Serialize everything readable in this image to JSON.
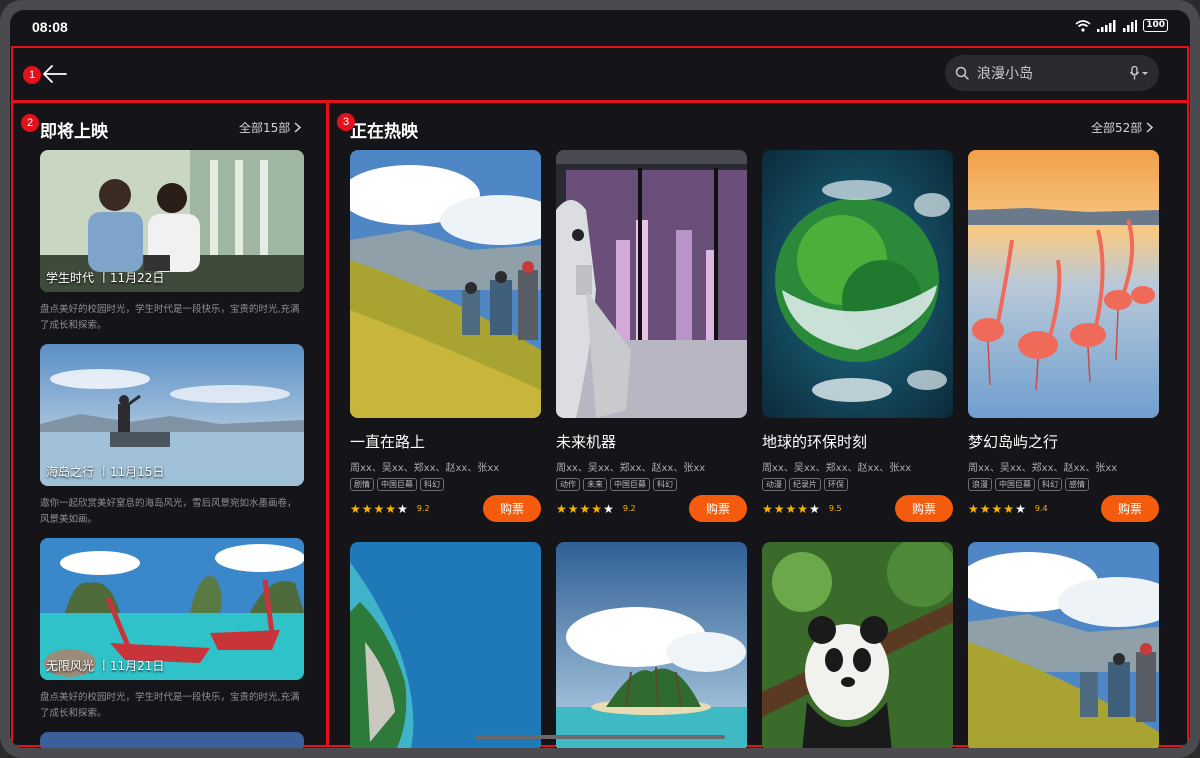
{
  "status": {
    "time": "08:08",
    "battery": "100"
  },
  "search": {
    "text": "浪漫小岛"
  },
  "regions": {
    "r1": "1",
    "r2": "2",
    "r3": "3"
  },
  "upcoming": {
    "title": "即将上映",
    "see_all": "全部15部",
    "items": [
      {
        "caption": "学生时代 丨11月22日",
        "desc": "盘点美好的校园时光，学生时代是一段快乐，宝贵的时光,充满了成长和探索。"
      },
      {
        "caption": "海岛之行 丨11月15日",
        "desc": "邀你一起欣赏美好窒息的海岛风光，雪后风景宛如水墨画卷，风景美如画。"
      },
      {
        "caption": "无限风光 丨11月21日",
        "desc": "盘点美好的校园时光，学生时代是一段快乐，宝贵的时光,充满了成长和探索。"
      }
    ]
  },
  "now_showing": {
    "title": "正在热映",
    "see_all": "全部52部",
    "buy_label": "购票",
    "movies": [
      {
        "title": "一直在路上",
        "cast": "周xx、吴xx、郑xx、赵xx、张xx",
        "tags": [
          "剧情",
          "中国巨幕",
          "科幻"
        ],
        "stars": 4,
        "rating": "9.2"
      },
      {
        "title": "未来机器",
        "cast": "周xx、吴xx、郑xx、赵xx、张xx",
        "tags": [
          "动作",
          "未来",
          "中国巨幕",
          "科幻"
        ],
        "stars": 4,
        "rating": "9.2"
      },
      {
        "title": "地球的环保时刻",
        "cast": "周xx、吴xx、郑xx、赵xx、张xx",
        "tags": [
          "动漫",
          "纪录片",
          "环保"
        ],
        "stars": 4,
        "rating": "9.5"
      },
      {
        "title": "梦幻岛屿之行",
        "cast": "周xx、吴xx、郑xx、赵xx、张xx",
        "tags": [
          "浪漫",
          "中国巨幕",
          "科幻",
          "感情"
        ],
        "stars": 4,
        "rating": "9.4"
      }
    ]
  },
  "colors": {
    "accent": "#f45b0d",
    "star": "#f7b500",
    "outline": "#e3111c"
  }
}
